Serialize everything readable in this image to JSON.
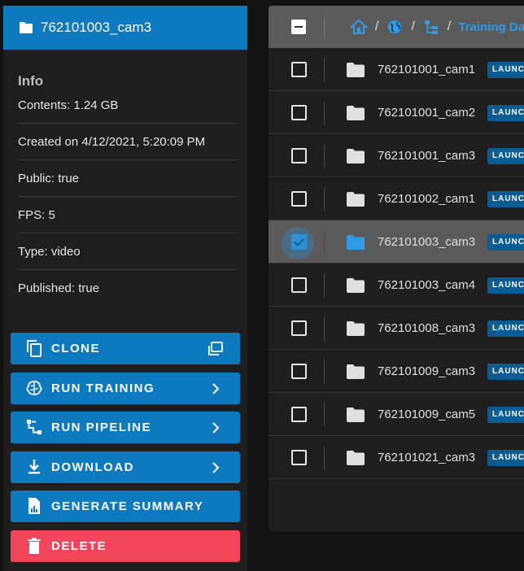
{
  "dataset": {
    "title": "762101003_cam3",
    "info_heading": "Info",
    "info": [
      "Contents: 1.24 GB",
      "Created on 4/12/2021, 5:20:09 PM",
      "Public: true",
      "FPS: 5",
      "Type: video",
      "Published: true"
    ]
  },
  "actions": [
    {
      "label": "CLONE",
      "icon": "clone-icon",
      "trailing": "clone-window-icon"
    },
    {
      "label": "RUN TRAINING",
      "icon": "brain-icon",
      "trailing": "chevron-right-icon"
    },
    {
      "label": "RUN PIPELINE",
      "icon": "pipeline-icon",
      "trailing": "chevron-right-icon"
    },
    {
      "label": "DOWNLOAD",
      "icon": "download-icon",
      "trailing": "chevron-right-icon"
    },
    {
      "label": "GENERATE SUMMARY",
      "icon": "summary-file-icon",
      "trailing": ""
    },
    {
      "label": "DELETE",
      "icon": "trash-icon",
      "trailing": ""
    }
  ],
  "breadcrumb": {
    "separator": "/",
    "current": "Training Data"
  },
  "files": [
    {
      "name": "762101001_cam1",
      "launch": "LAUNC",
      "selected": false
    },
    {
      "name": "762101001_cam2",
      "launch": "LAUNC",
      "selected": false
    },
    {
      "name": "762101001_cam3",
      "launch": "LAUNC",
      "selected": false
    },
    {
      "name": "762101002_cam1",
      "launch": "LAUNC",
      "selected": false
    },
    {
      "name": "762101003_cam3",
      "launch": "LAUNC",
      "selected": true
    },
    {
      "name": "762101003_cam4",
      "launch": "LAUNC",
      "selected": false
    },
    {
      "name": "762101008_cam3",
      "launch": "LAUNC",
      "selected": false
    },
    {
      "name": "762101009_cam3",
      "launch": "LAUNC",
      "selected": false
    },
    {
      "name": "762101009_cam5",
      "launch": "LAUNC",
      "selected": false
    },
    {
      "name": "762101021_cam3",
      "launch": "LAUNC",
      "selected": false
    }
  ],
  "colors": {
    "accent": "#0d79bf",
    "danger": "#f2445a",
    "link": "#2e9be6"
  }
}
